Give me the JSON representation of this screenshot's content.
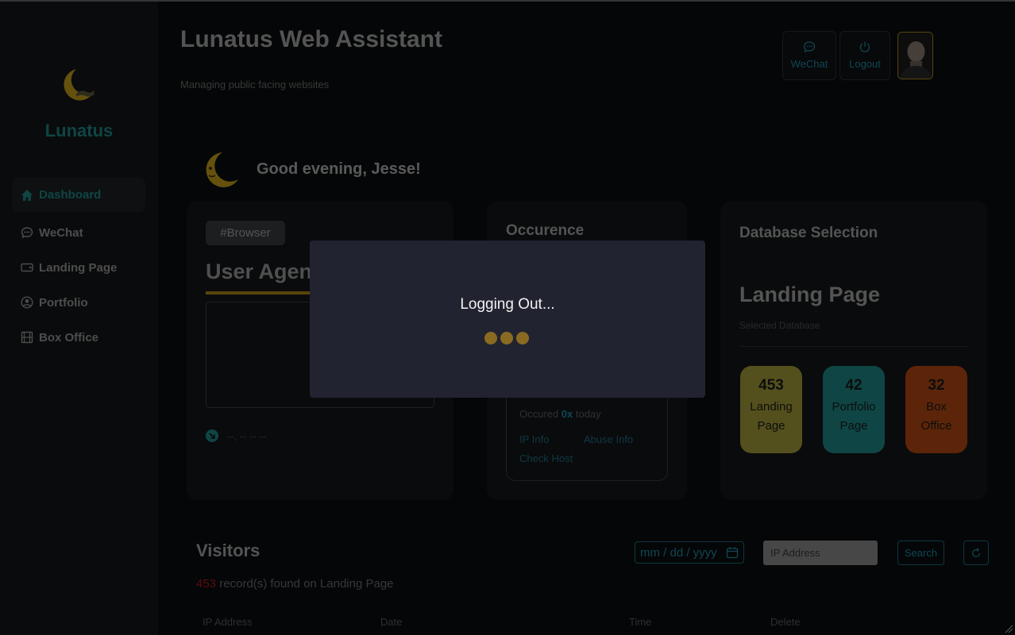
{
  "app": {
    "title": "Lunatus Web Assistant",
    "subtitle": "Managing public facing websites",
    "brand": "Lunatus"
  },
  "header": {
    "wechat_label": "WeChat",
    "logout_label": "Logout"
  },
  "sidebar": {
    "items": [
      {
        "label": "Dashboard",
        "icon": "home-icon",
        "active": true
      },
      {
        "label": "WeChat",
        "icon": "chat-icon",
        "active": false
      },
      {
        "label": "Landing Page",
        "icon": "card-icon",
        "active": false
      },
      {
        "label": "Portfolio",
        "icon": "user-circle-icon",
        "active": false
      },
      {
        "label": "Box Office",
        "icon": "film-icon",
        "active": false
      }
    ]
  },
  "greeting": "Good evening, Jesse!",
  "browser_card": {
    "tag": "#Browser",
    "title": "User Agent",
    "footer": "--, -- -- --"
  },
  "occurrence_card": {
    "title": "Occurence",
    "occured_prefix": "Occured",
    "occured_count": "0x",
    "occured_suffix": "today",
    "links": [
      "IP Info",
      "Abuse Info",
      "Check Host"
    ]
  },
  "database_card": {
    "title": "Database Selection",
    "selected": "Landing Page",
    "selected_label": "Selected Database",
    "tiles": [
      {
        "count": "453",
        "label": "Landing Page",
        "color": "#a7a03a"
      },
      {
        "count": "42",
        "label": "Portfolio Page",
        "color": "#1f8a8a"
      },
      {
        "count": "32",
        "label": "Box Office",
        "color": "#b84a12"
      }
    ]
  },
  "visitors": {
    "title": "Visitors",
    "count": "453",
    "count_suffix": "record(s) found on Landing Page",
    "date_placeholder": "mm / dd / yyyy",
    "ip_placeholder": "IP Address",
    "search_label": "Search",
    "columns": [
      "IP Address",
      "Date",
      "Time",
      "Delete"
    ]
  },
  "modal": {
    "message": "Logging Out..."
  },
  "colors": {
    "accent": "#1f8a8a",
    "gold": "#b08a1c",
    "link": "#1c8fa8"
  }
}
